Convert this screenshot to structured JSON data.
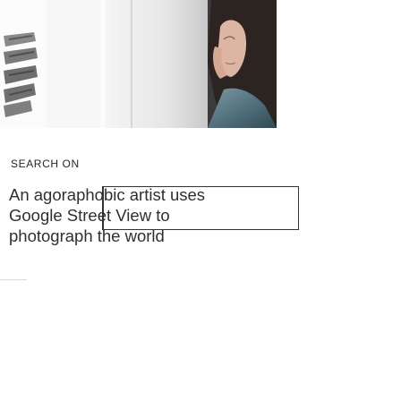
{
  "article": {
    "kicker": "SEARCH ON",
    "headline_lines": [
      "An agoraphobic artist uses",
      "Google Street View to",
      "photograph the world"
    ]
  },
  "colors": {
    "text": "#2f2f2f",
    "highlight_border": "#333333"
  }
}
